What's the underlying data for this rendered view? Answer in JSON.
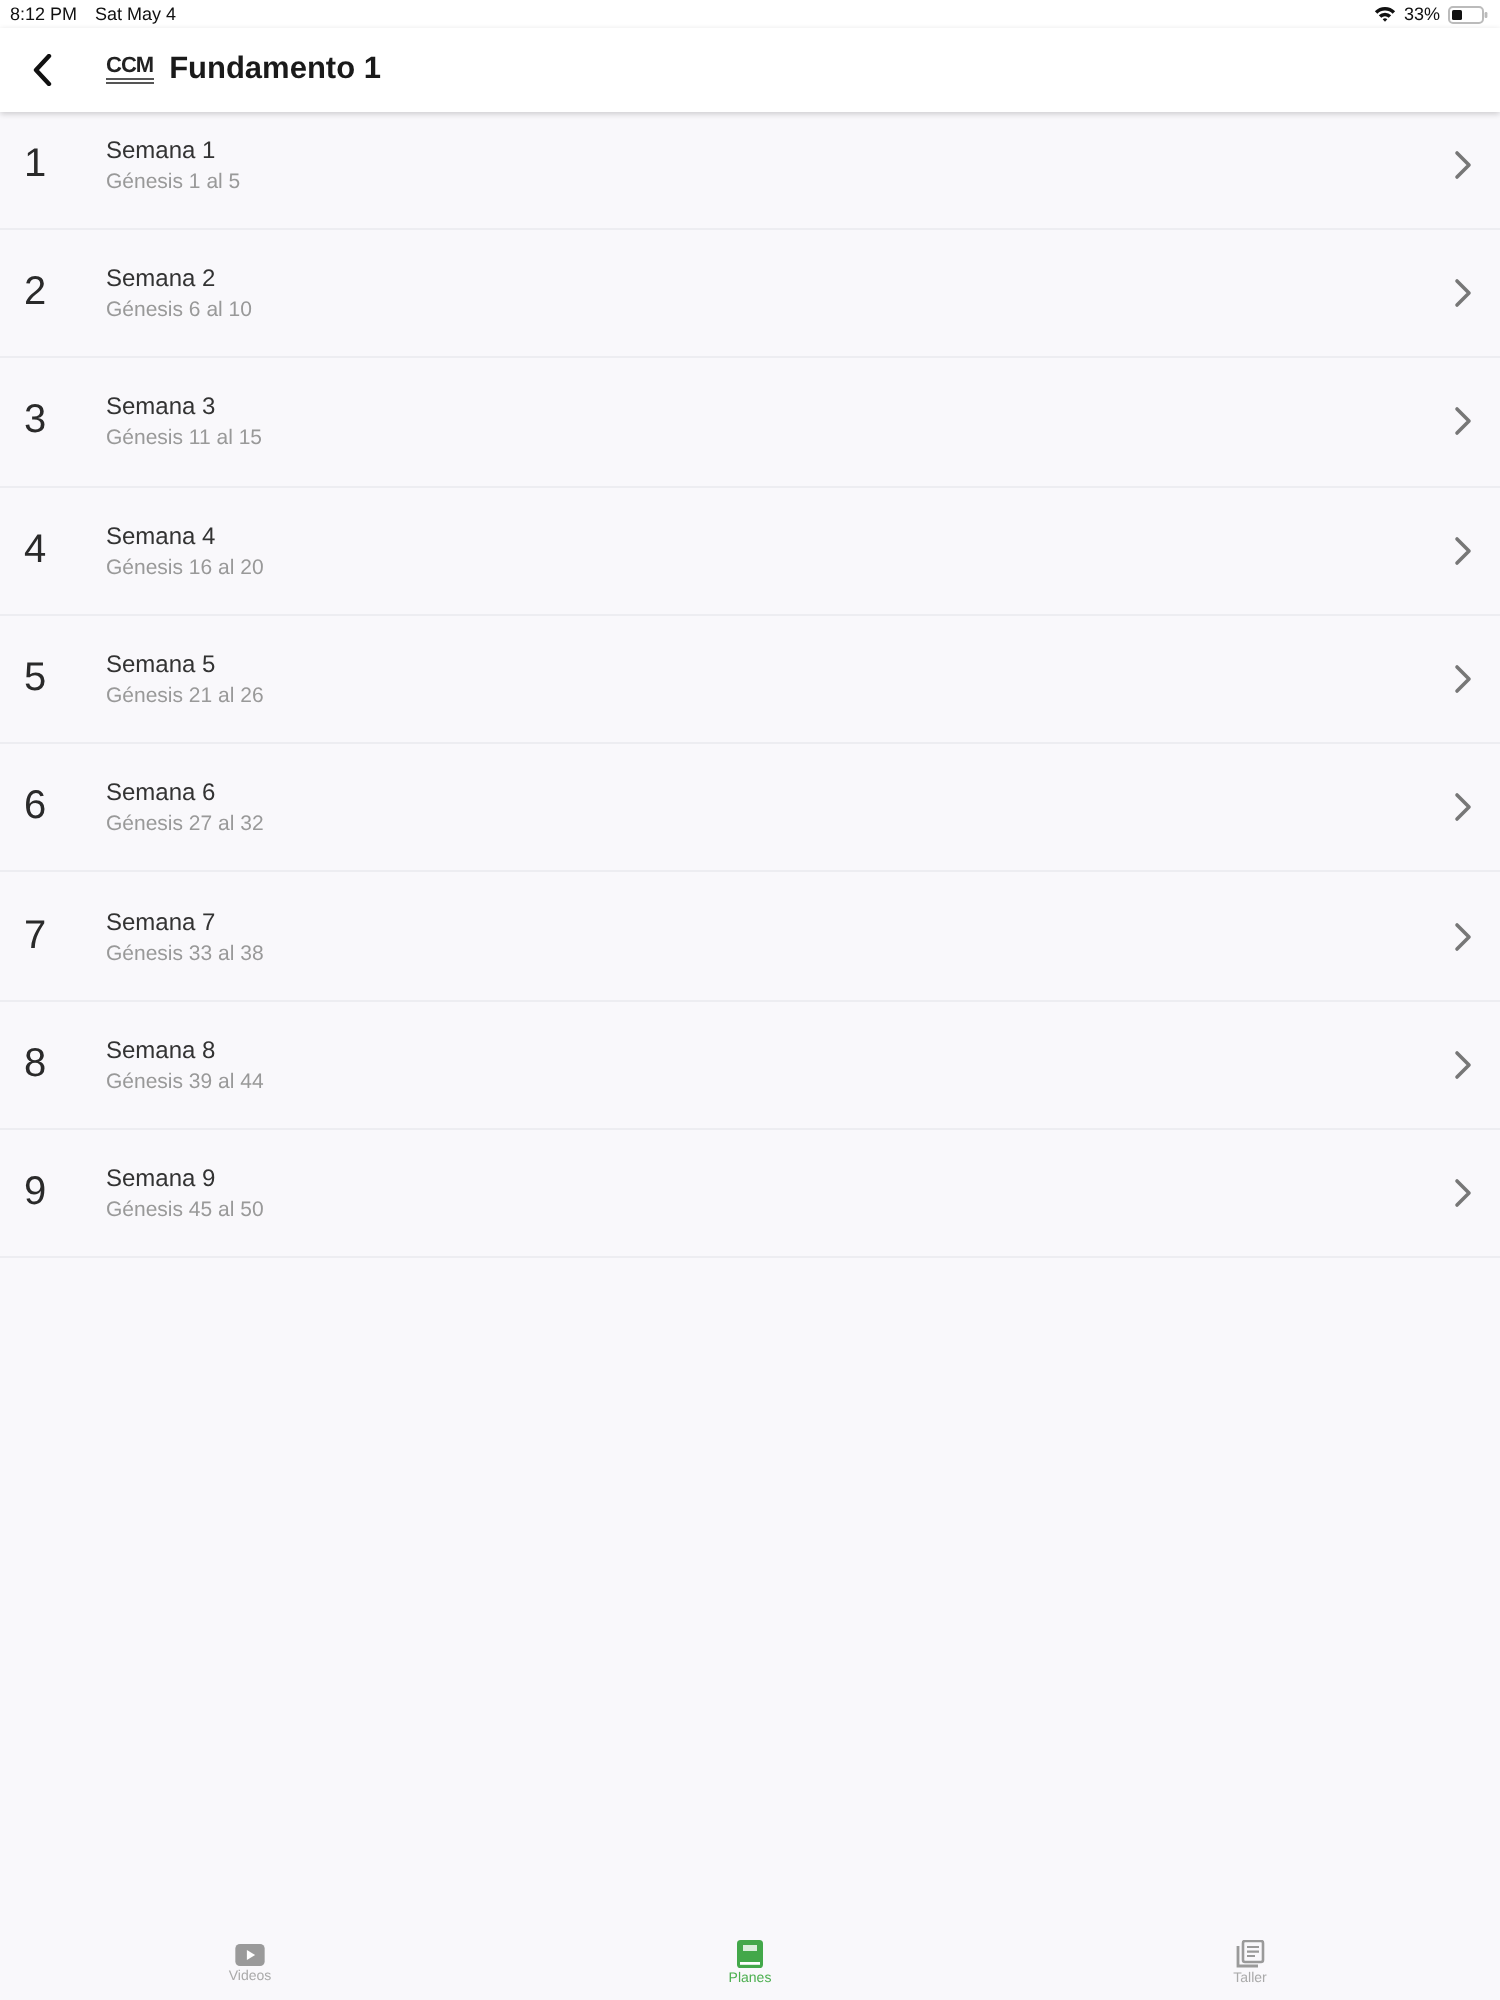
{
  "status_bar": {
    "time": "8:12 PM",
    "date": "Sat May 4",
    "battery": "33%"
  },
  "nav_bar": {
    "logo": "CCM",
    "title": "Fundamento 1"
  },
  "weeks": [
    {
      "number": "1",
      "title": "Semana 1",
      "subtitle": "Génesis 1 al 5"
    },
    {
      "number": "2",
      "title": "Semana 2",
      "subtitle": "Génesis 6 al 10"
    },
    {
      "number": "3",
      "title": "Semana 3",
      "subtitle": "Génesis 11 al 15"
    },
    {
      "number": "4",
      "title": "Semana 4",
      "subtitle": "Génesis 16 al 20"
    },
    {
      "number": "5",
      "title": "Semana 5",
      "subtitle": "Génesis 21 al 26"
    },
    {
      "number": "6",
      "title": "Semana 6",
      "subtitle": "Génesis 27 al 32"
    },
    {
      "number": "7",
      "title": "Semana 7",
      "subtitle": "Génesis 33 al 38"
    },
    {
      "number": "8",
      "title": "Semana 8",
      "subtitle": "Génesis 39 al 44"
    },
    {
      "number": "9",
      "title": "Semana 9",
      "subtitle": "Génesis 45 al 50"
    }
  ],
  "tabs": [
    {
      "kind": "video",
      "label": "Videos",
      "selected": false
    },
    {
      "kind": "book",
      "label": "Planes",
      "selected": true
    },
    {
      "kind": "docs",
      "label": "Taller",
      "selected": false
    }
  ]
}
